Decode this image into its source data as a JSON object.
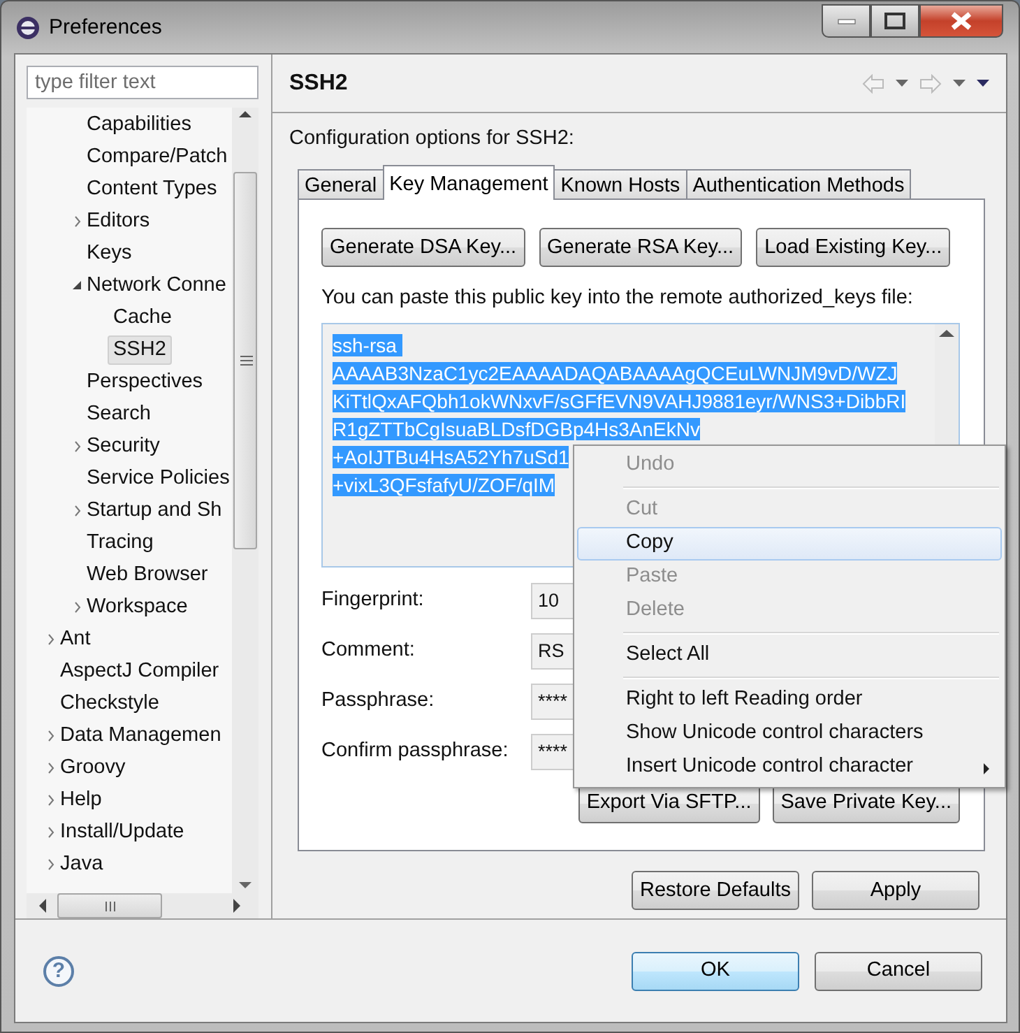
{
  "window": {
    "title": "Preferences"
  },
  "filter": {
    "placeholder": "type filter text"
  },
  "tree": {
    "continued_children": [
      {
        "label": "Capabilities",
        "selected": false
      },
      {
        "label": "Compare/Patch",
        "selected": false
      },
      {
        "label": "Content Types",
        "selected": false
      },
      {
        "label": "Editors",
        "selected": false,
        "expanded": false
      },
      {
        "label": "Keys",
        "selected": false
      },
      {
        "label": "Network Conne",
        "selected": false,
        "expanded": true,
        "children": [
          {
            "label": "Cache",
            "selected": false
          },
          {
            "label": "SSH2",
            "selected": true
          }
        ]
      },
      {
        "label": "Perspectives",
        "selected": false
      },
      {
        "label": "Search",
        "selected": false
      },
      {
        "label": "Security",
        "selected": false,
        "expanded": false
      },
      {
        "label": "Service Policies",
        "selected": false
      },
      {
        "label": "Startup and Sh",
        "selected": false,
        "expanded": false
      },
      {
        "label": "Tracing",
        "selected": false
      },
      {
        "label": "Web Browser",
        "selected": false
      },
      {
        "label": "Workspace",
        "selected": false,
        "expanded": false
      }
    ],
    "items": [
      {
        "label": "Ant",
        "selected": false,
        "expanded": false
      },
      {
        "label": "AspectJ Compiler",
        "selected": false
      },
      {
        "label": "Checkstyle",
        "selected": false
      },
      {
        "label": "Data Managemen",
        "selected": false,
        "expanded": false
      },
      {
        "label": "Groovy",
        "selected": false,
        "expanded": false
      },
      {
        "label": "Help",
        "selected": false,
        "expanded": false
      },
      {
        "label": "Install/Update",
        "selected": false,
        "expanded": false
      },
      {
        "label": "Java",
        "selected": false,
        "expanded": false
      }
    ]
  },
  "page": {
    "title": "SSH2",
    "description": "Configuration options for SSH2:"
  },
  "tabs": [
    {
      "label": "General",
      "selected": false
    },
    {
      "label": "Key Management",
      "selected": true
    },
    {
      "label": "Known Hosts",
      "selected": false
    },
    {
      "label": "Authentication Methods",
      "selected": false
    }
  ],
  "key_buttons": [
    "Generate DSA Key...",
    "Generate RSA Key...",
    "Load Existing Key..."
  ],
  "public_key": {
    "label": "You can paste this public key into the remote authorized_keys file:",
    "lines": [
      "ssh-rsa ",
      "AAAAB3NzaC1yc2EAAAADAQABAAAAgQCEuLWNJM9vD/WZJ",
      "KiTtlQxAFQbh1okWNxvF/sGFfEVN9VAHJ9881eyr/WNS3+DibbRI",
      "R1gZTTbCgIsuaBLDsfDGBp4Hs3AnEkNv",
      "+AoIJTBu4HsA52Yh7uSd1",
      "+vixL3QFsfafyU/ZOF/qIM"
    ]
  },
  "fields": [
    {
      "label": "Fingerprint:",
      "value": "10"
    },
    {
      "label": "Comment:",
      "value": "RS"
    },
    {
      "label": "Passphrase:",
      "value": "****"
    },
    {
      "label": "Confirm passphrase:",
      "value": "****"
    }
  ],
  "panel_buttons": [
    "Export Via SFTP...",
    "Save Private Key..."
  ],
  "page_buttons": [
    "Restore Defaults",
    "Apply"
  ],
  "help": {
    "glyph": "?"
  },
  "dialog_buttons": [
    {
      "label": "OK",
      "default": true
    },
    {
      "label": "Cancel",
      "default": false
    }
  ],
  "context_menu": [
    {
      "kind": "item",
      "label": "Undo",
      "disabled": true,
      "selected": false
    },
    {
      "kind": "separator"
    },
    {
      "kind": "item",
      "label": "Cut",
      "disabled": true,
      "selected": false
    },
    {
      "kind": "item",
      "label": "Copy",
      "disabled": false,
      "selected": true
    },
    {
      "kind": "item",
      "label": "Paste",
      "disabled": true,
      "selected": false
    },
    {
      "kind": "item",
      "label": "Delete",
      "disabled": true,
      "selected": false
    },
    {
      "kind": "separator"
    },
    {
      "kind": "item",
      "label": "Select All",
      "disabled": false,
      "selected": false
    },
    {
      "kind": "separator"
    },
    {
      "kind": "item",
      "label": "Right to left Reading order",
      "disabled": false,
      "selected": false
    },
    {
      "kind": "item",
      "label": "Show Unicode control characters",
      "disabled": false,
      "selected": false
    },
    {
      "kind": "submenu",
      "label": "Insert Unicode control character",
      "disabled": false,
      "selected": false
    }
  ]
}
